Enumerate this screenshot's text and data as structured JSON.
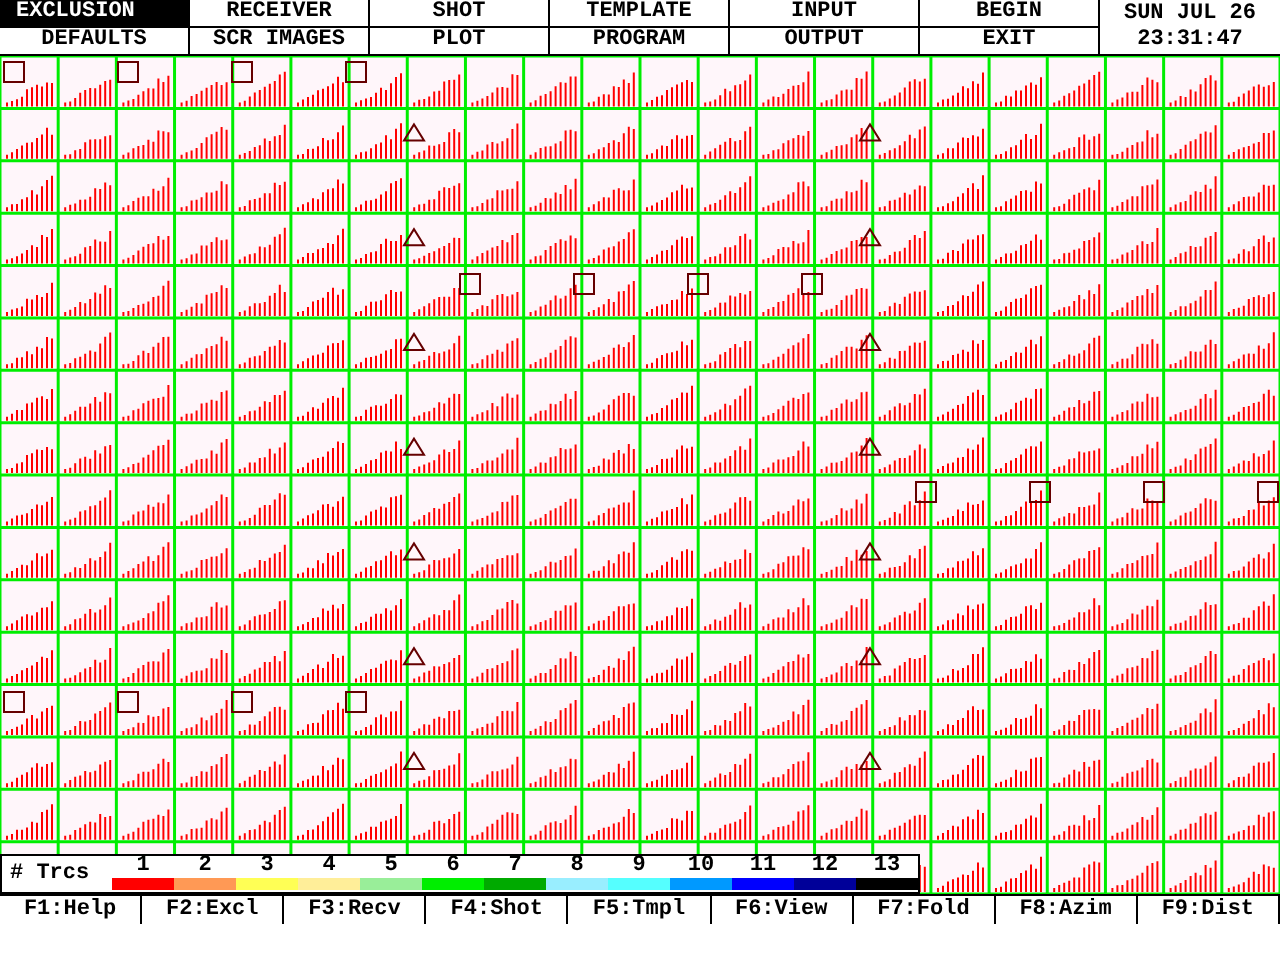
{
  "menu": [
    {
      "label": "EXCLUSION",
      "selected": true
    },
    {
      "label": "RECEIVER",
      "selected": false
    },
    {
      "label": "SHOT",
      "selected": false
    },
    {
      "label": "TEMPLATE",
      "selected": false
    },
    {
      "label": "INPUT",
      "selected": false
    },
    {
      "label": "BEGIN",
      "selected": false
    },
    {
      "label": "DEFAULTS",
      "selected": false
    },
    {
      "label": "SCR IMAGES",
      "selected": false
    },
    {
      "label": "PLOT",
      "selected": false
    },
    {
      "label": "PROGRAM",
      "selected": false
    },
    {
      "label": "OUTPUT",
      "selected": false
    },
    {
      "label": "EXIT",
      "selected": false
    }
  ],
  "date": "SUN JUL 26",
  "time": "23:31:47",
  "legend": {
    "title": "# Trcs",
    "items": [
      {
        "label": "1",
        "color": "#ff0000"
      },
      {
        "label": "2",
        "color": "#ff9955"
      },
      {
        "label": "3",
        "color": "#ffff55"
      },
      {
        "label": "4",
        "color": "#ffee99"
      },
      {
        "label": "5",
        "color": "#99ee99"
      },
      {
        "label": "6",
        "color": "#00ee00"
      },
      {
        "label": "7",
        "color": "#00aa00"
      },
      {
        "label": "8",
        "color": "#99eeff"
      },
      {
        "label": "9",
        "color": "#55ffff"
      },
      {
        "label": "10",
        "color": "#0099ff"
      },
      {
        "label": "11",
        "color": "#0000ff"
      },
      {
        "label": "12",
        "color": "#000099"
      },
      {
        "label": "13",
        "color": "#000000"
      }
    ]
  },
  "function_keys": [
    "F1:Help",
    "F2:Excl",
    "F3:Recv",
    "F4:Shot",
    "F5:Tmpl",
    "F6:View",
    "F7:Fold",
    "F8:Azim",
    "F9:Dist"
  ]
}
